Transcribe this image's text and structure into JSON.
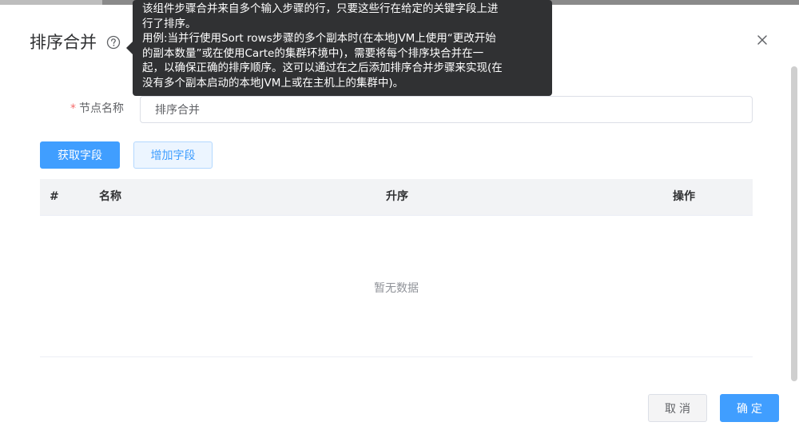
{
  "dialog": {
    "title": "排序合并",
    "help_icon": "question-circle-icon",
    "close_icon": "close-icon"
  },
  "tooltip": {
    "lines": [
      "该组件步骤合并来自多个输入步骤的行，只要这些行在给定的关键字段上进",
      "行了排序。",
      "用例:当并行使用Sort rows步骤的多个副本时(在本地JVM上使用“更改开始",
      "的副本数量”或在使用Carte的集群环境中)，需要将每个排序块合并在一",
      "起，以确保正确的排序顺序。这可以通过在之后添加排序合并步骤来实现(在",
      "没有多个副本启动的本地JVM上或在主机上的集群中)。"
    ]
  },
  "form": {
    "required_mark": "*",
    "node_name_label": "节点名称",
    "node_name_value": "排序合并"
  },
  "toolbar": {
    "fetch_fields_label": "获取字段",
    "add_field_label": "增加字段"
  },
  "table": {
    "columns": [
      "#",
      "名称",
      "升序",
      "操作"
    ],
    "rows": [],
    "empty_text": "暂无数据"
  },
  "footer": {
    "cancel_label": "取消",
    "ok_label": "确定"
  },
  "colors": {
    "primary": "#409eff",
    "tooltip_bg": "#303133",
    "required": "#f56c6c"
  }
}
